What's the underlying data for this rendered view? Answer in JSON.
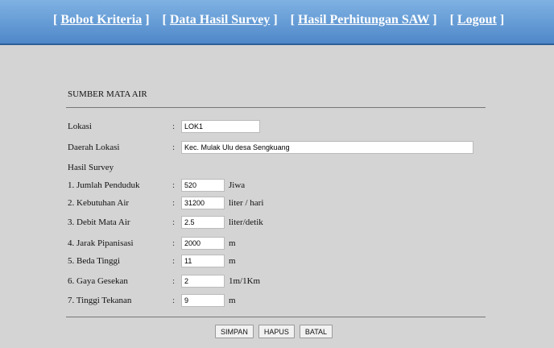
{
  "nav": {
    "open_bracket": "[",
    "close_bracket": "]",
    "items": [
      "Bobot Kriteria",
      "Data Hasil Survey",
      "Hasil Perhitungan SAW",
      "Logout"
    ]
  },
  "form": {
    "title": "SUMBER MATA AIR",
    "colon": ":",
    "fields": [
      {
        "label": "Lokasi",
        "value": "LOK1",
        "unit": ""
      },
      {
        "label": "Daerah Lokasi",
        "value": "Kec. Mulak Ulu desa Sengkuang",
        "unit": ""
      }
    ],
    "survey_heading": "Hasil Survey",
    "survey": [
      {
        "label": "1. Jumlah Penduduk",
        "value": "520",
        "unit": "Jiwa"
      },
      {
        "label": "2. Kebutuhan Air",
        "value": "31200",
        "unit": "liter / hari"
      },
      {
        "label": "3. Debit Mata Air",
        "value": "2.5",
        "unit": "liter/detik"
      },
      {
        "label": "4. Jarak Pipanisasi",
        "value": "2000",
        "unit": "m"
      },
      {
        "label": "5. Beda Tinggi",
        "value": "11",
        "unit": "m"
      },
      {
        "label": "6. Gaya Gesekan",
        "value": "2",
        "unit": "1m/1Km"
      },
      {
        "label": "7. Tinggi Tekanan",
        "value": "9",
        "unit": "m"
      }
    ]
  },
  "buttons": {
    "simpan": "SIMPAN",
    "hapus": "HAPUS",
    "batal": "BATAL"
  }
}
